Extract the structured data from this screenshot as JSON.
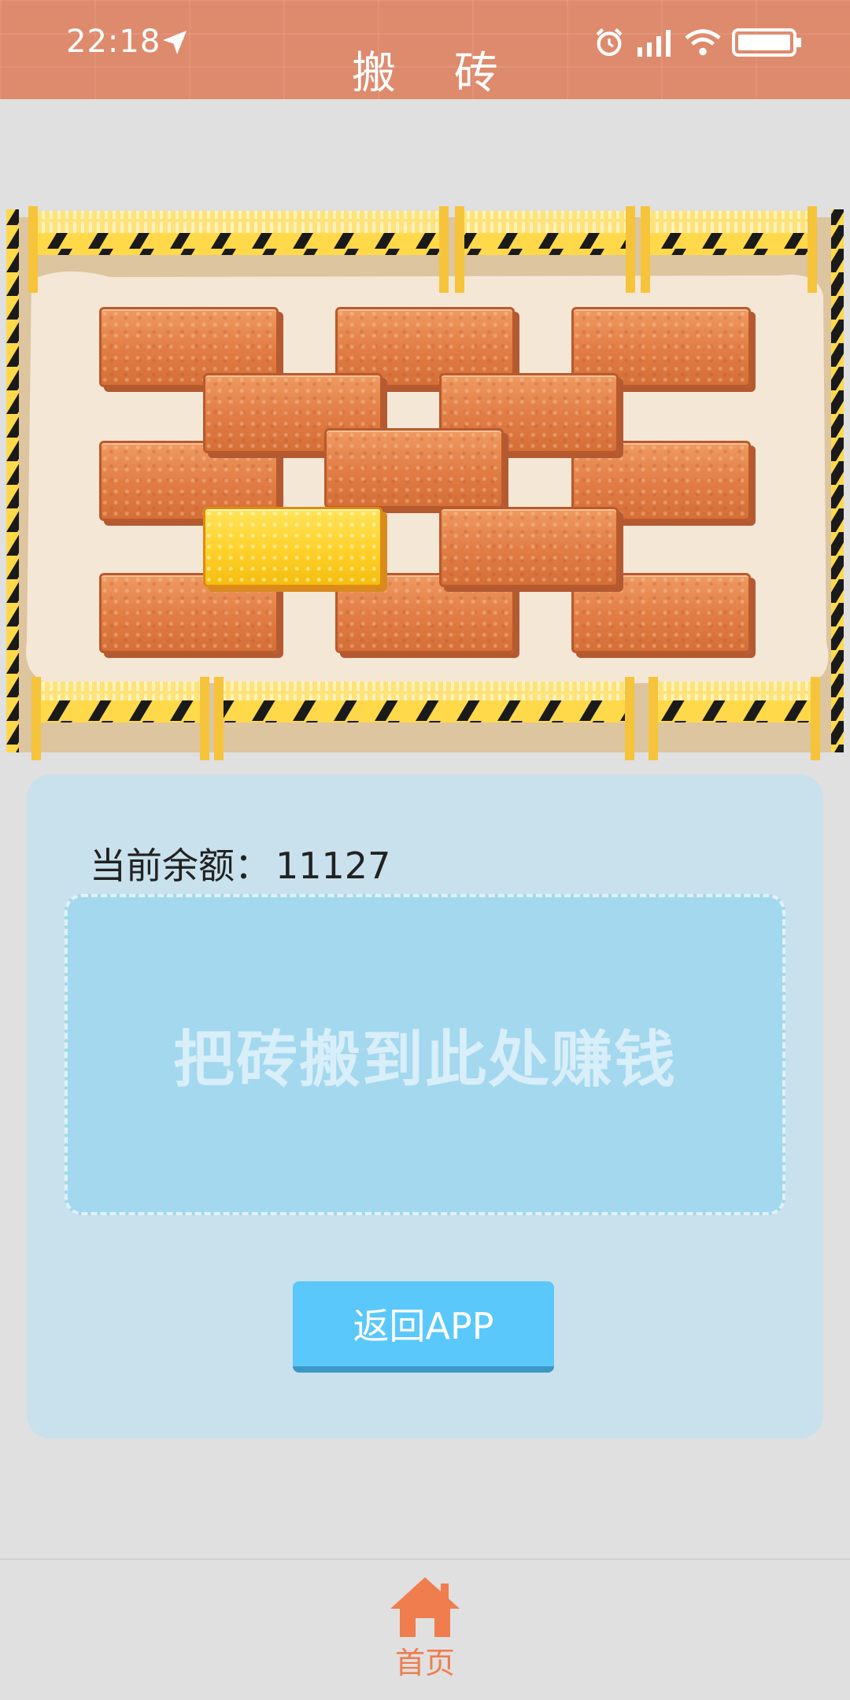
{
  "status_bar": {
    "time": "22:18"
  },
  "header": {
    "title": "搬 砖"
  },
  "balance": {
    "label": "当前余额：",
    "value": "11127"
  },
  "drop_zone": {
    "text": "把砖搬到此处赚钱"
  },
  "buttons": {
    "return_label": "返回APP"
  },
  "bottom_nav": {
    "items": [
      {
        "label": "首页",
        "icon": "home-icon",
        "active": true
      }
    ]
  },
  "colors": {
    "header": "#de8a6c",
    "brick": "#e07c44",
    "gold_brick": "#ffd12b",
    "panel": "#c9e1ec",
    "drop_zone": "#a3d8ef",
    "button": "#5ac8fa",
    "nav_active": "#ef7d4e"
  }
}
